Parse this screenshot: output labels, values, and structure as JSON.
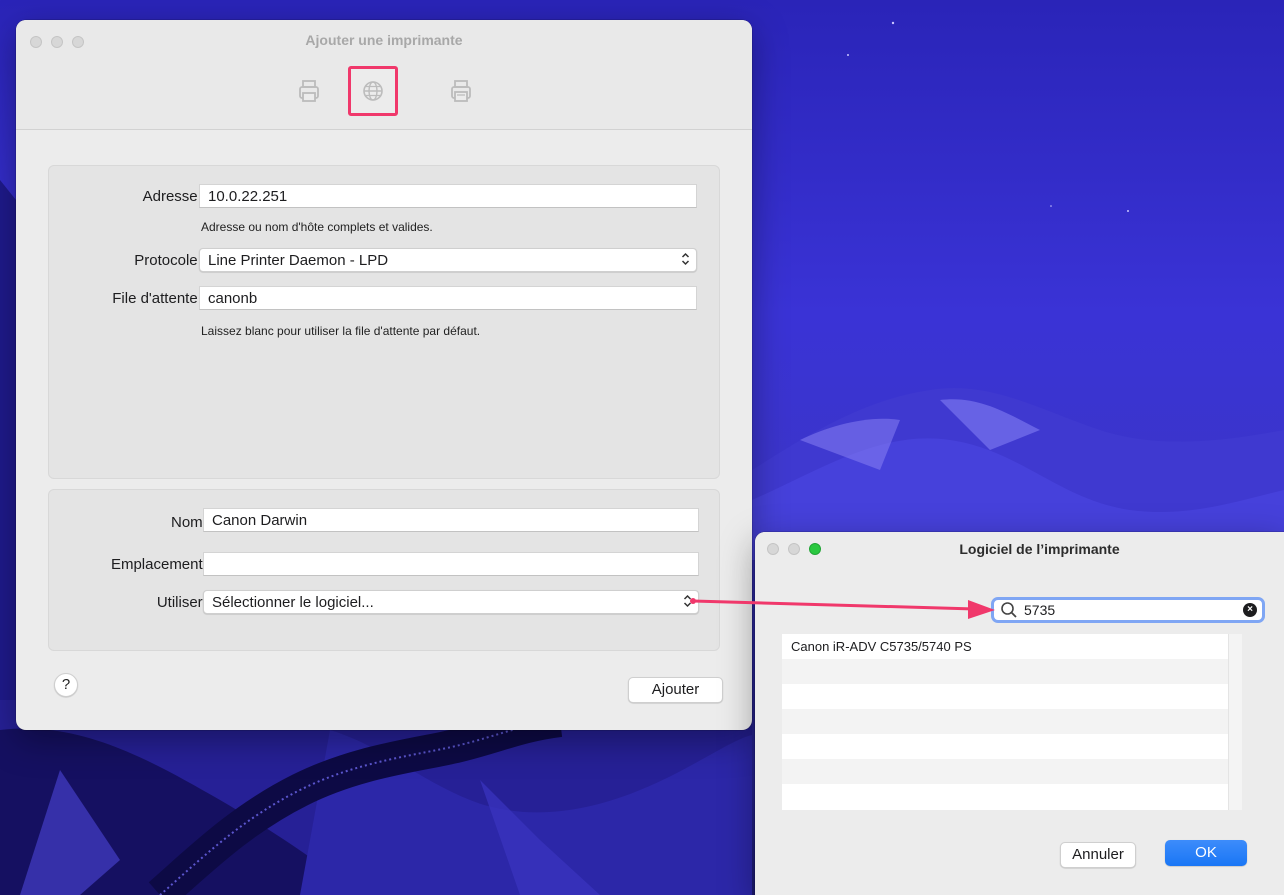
{
  "main_window": {
    "title": "Ajouter une imprimante",
    "toolbar": [
      {
        "name": "default-printer-icon",
        "selected": false
      },
      {
        "name": "ip-globe-icon",
        "selected": true
      },
      {
        "name": "windows-printer-icon",
        "selected": false
      }
    ],
    "address": {
      "label": "Adresse :",
      "value": "10.0.22.251",
      "hint": "Adresse ou nom d'hôte complets et valides."
    },
    "protocol": {
      "label": "Protocole :",
      "value": "Line Printer Daemon - LPD"
    },
    "queue": {
      "label": "File d'attente :",
      "value": "canonb",
      "hint": "Laissez blanc pour utiliser la file d'attente par défaut."
    },
    "name": {
      "label": "Nom :",
      "value": "Canon Darwin"
    },
    "location": {
      "label": "Emplacement :",
      "value": ""
    },
    "use": {
      "label": "Utiliser :",
      "value": "Sélectionner le logiciel..."
    },
    "help_label": "?",
    "add_button": "Ajouter"
  },
  "software_window": {
    "title": "Logiciel de l’imprimante",
    "search_value": "5735",
    "results": [
      "Canon iR-ADV C5735/5740 PS",
      "",
      "",
      "",
      "",
      "",
      ""
    ],
    "cancel_button": "Annuler",
    "ok_button": "OK"
  },
  "colors": {
    "highlight": "#f0386b",
    "accent": "#1976f5",
    "wallpaper": "#3a33d6"
  }
}
